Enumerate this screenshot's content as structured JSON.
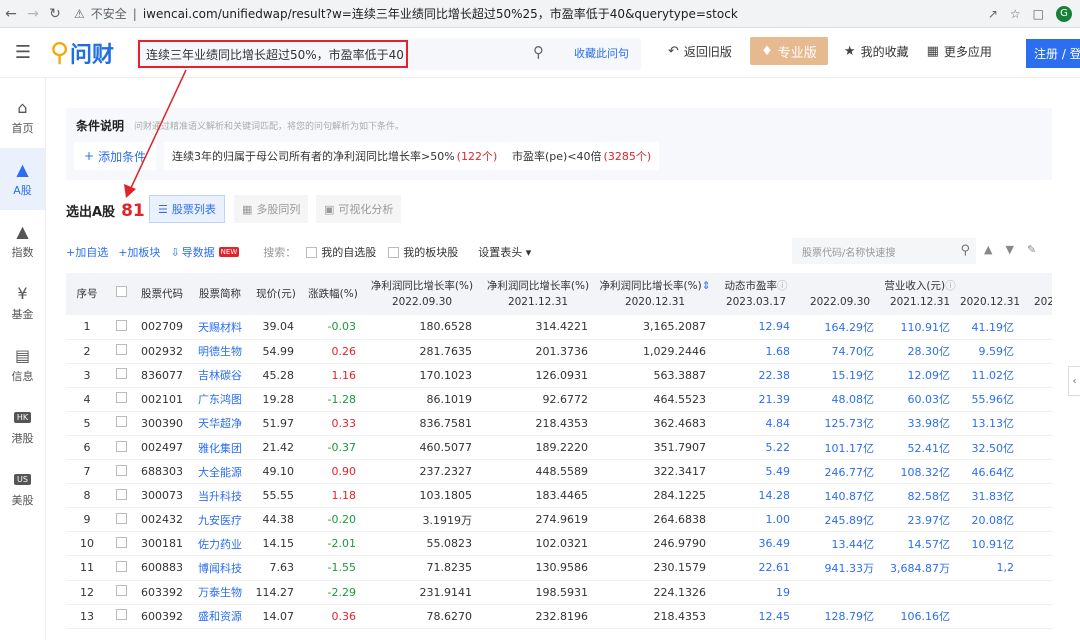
{
  "browser": {
    "security_label": "不安全",
    "url": "iwencai.com/unifiedwap/result?w=连续三年业绩同比增长超过50%25，市盈率低于40&querytype=stock",
    "profile_initial": "G"
  },
  "header": {
    "logo_text": "问财",
    "query": "连续三年业绩同比增长超过50%，市盈率低于40",
    "fav_query": "收藏此问句",
    "back_old": "返回旧版",
    "pro": "专业版",
    "my_fav": "我的收藏",
    "more_apps": "更多应用",
    "register": "注册 / 登录"
  },
  "sidebar": {
    "items": [
      {
        "label": "首页",
        "icon": "home-icon"
      },
      {
        "label": "A股",
        "icon": "chart-icon"
      },
      {
        "label": "指数",
        "icon": "index-icon"
      },
      {
        "label": "基金",
        "icon": "yen-icon"
      },
      {
        "label": "信息",
        "icon": "doc-icon"
      },
      {
        "label": "港股",
        "icon": "hk-icon",
        "badge": "HK"
      },
      {
        "label": "美股",
        "icon": "us-icon",
        "badge": "US"
      }
    ]
  },
  "conditions": {
    "title": "条件说明",
    "desc": "问财通过精准语义解析和关键词匹配，将您的问句解析为如下条件。",
    "add": "添加条件",
    "chips": [
      {
        "text": "连续3年的归属于母公司所有者的净利润同比增长率>50%",
        "count": "(122个)"
      },
      {
        "text": "市盈率(pe)<40倍",
        "count": "(3285个)"
      }
    ]
  },
  "results": {
    "label": "选出A股",
    "count": "81",
    "tabs": [
      "股票列表",
      "多股同列",
      "可视化分析"
    ]
  },
  "toolbar": {
    "add_watch": "+加自选",
    "add_block": "+加板块",
    "export": "导数据",
    "new": "NEW",
    "search_label": "搜索：",
    "my_watch": "我的自选股",
    "my_block": "我的板块股",
    "header_setting": "设置表头",
    "search_placeholder": "股票代码/名称快速搜"
  },
  "table": {
    "headers": {
      "idx": "序号",
      "code": "股票代码",
      "name": "股票简称",
      "price": "现价(元)",
      "chg": "涨跌幅(%)",
      "np1": "净利润同比增长率(%)",
      "np1_date": "2022.09.30",
      "np2": "净利润同比增长率(%)",
      "np2_date": "2021.12.31",
      "np3": "净利润同比增长率(%)",
      "np3_date": "2020.12.31",
      "pe": "动态市盈率",
      "pe_date": "2023.03.17",
      "rev": "营业收入(元)",
      "rev_d1": "2022.09.30",
      "rev_d2": "2021.12.31",
      "rev_d3": "2020.12.31",
      "rev_d4": "202"
    },
    "rows": [
      {
        "idx": "1",
        "code": "002709",
        "name": "天赐材料",
        "price": "39.04",
        "chg": "-0.03",
        "np1": "180.6528",
        "np2": "314.4221",
        "np3": "3,165.2087",
        "pe": "12.94",
        "r1": "164.29亿",
        "r2": "110.91亿",
        "r3": "41.19亿"
      },
      {
        "idx": "2",
        "code": "002932",
        "name": "明德生物",
        "price": "54.99",
        "chg": "0.26",
        "np1": "281.7635",
        "np2": "201.3736",
        "np3": "1,029.2446",
        "pe": "1.68",
        "r1": "74.70亿",
        "r2": "28.30亿",
        "r3": "9.59亿"
      },
      {
        "idx": "3",
        "code": "836077",
        "name": "吉林碳谷",
        "price": "45.28",
        "chg": "1.16",
        "np1": "170.1023",
        "np2": "126.0931",
        "np3": "563.3887",
        "pe": "22.38",
        "r1": "15.19亿",
        "r2": "12.09亿",
        "r3": "11.02亿"
      },
      {
        "idx": "4",
        "code": "002101",
        "name": "广东鸿图",
        "price": "19.28",
        "chg": "-1.28",
        "np1": "86.1019",
        "np2": "92.6772",
        "np3": "464.5523",
        "pe": "21.39",
        "r1": "48.08亿",
        "r2": "60.03亿",
        "r3": "55.96亿"
      },
      {
        "idx": "5",
        "code": "300390",
        "name": "天华超净",
        "price": "51.97",
        "chg": "0.33",
        "np1": "836.7581",
        "np2": "218.4353",
        "np3": "362.4683",
        "pe": "4.84",
        "r1": "125.73亿",
        "r2": "33.98亿",
        "r3": "13.13亿"
      },
      {
        "idx": "6",
        "code": "002497",
        "name": "雅化集团",
        "price": "21.42",
        "chg": "-0.37",
        "np1": "460.5077",
        "np2": "189.2220",
        "np3": "351.7907",
        "pe": "5.22",
        "r1": "101.17亿",
        "r2": "52.41亿",
        "r3": "32.50亿"
      },
      {
        "idx": "7",
        "code": "688303",
        "name": "大全能源",
        "price": "49.10",
        "chg": "0.90",
        "np1": "237.2327",
        "np2": "448.5589",
        "np3": "322.3417",
        "pe": "5.49",
        "r1": "246.77亿",
        "r2": "108.32亿",
        "r3": "46.64亿"
      },
      {
        "idx": "8",
        "code": "300073",
        "name": "当升科技",
        "price": "55.55",
        "chg": "1.18",
        "np1": "103.1805",
        "np2": "183.4465",
        "np3": "284.1225",
        "pe": "14.28",
        "r1": "140.87亿",
        "r2": "82.58亿",
        "r3": "31.83亿"
      },
      {
        "idx": "9",
        "code": "002432",
        "name": "九安医疗",
        "price": "44.38",
        "chg": "-0.20",
        "np1": "3.1919万",
        "np2": "274.9619",
        "np3": "264.6838",
        "pe": "1.00",
        "r1": "245.89亿",
        "r2": "23.97亿",
        "r3": "20.08亿"
      },
      {
        "idx": "10",
        "code": "300181",
        "name": "佐力药业",
        "price": "14.15",
        "chg": "-2.01",
        "np1": "55.0823",
        "np2": "102.0321",
        "np3": "246.9790",
        "pe": "36.49",
        "r1": "13.44亿",
        "r2": "14.57亿",
        "r3": "10.91亿"
      },
      {
        "idx": "11",
        "code": "600883",
        "name": "博闻科技",
        "price": "7.63",
        "chg": "-1.55",
        "np1": "71.8235",
        "np2": "130.9586",
        "np3": "230.1579",
        "pe": "22.61",
        "r1": "941.33万",
        "r2": "3,684.87万",
        "r3": "1,2"
      },
      {
        "idx": "12",
        "code": "603392",
        "name": "万泰生物",
        "price": "114.27",
        "chg": "-2.29",
        "np1": "231.9141",
        "np2": "198.5931",
        "np3": "224.1326",
        "pe": "19",
        "r1": "",
        "r2": "",
        "r3": ""
      },
      {
        "idx": "13",
        "code": "600392",
        "name": "盛和资源",
        "price": "14.07",
        "chg": "0.36",
        "np1": "78.6270",
        "np2": "232.8196",
        "np3": "218.4353",
        "pe": "12.45",
        "r1": "128.79亿",
        "r2": "106.16亿",
        "r3": ""
      }
    ]
  }
}
